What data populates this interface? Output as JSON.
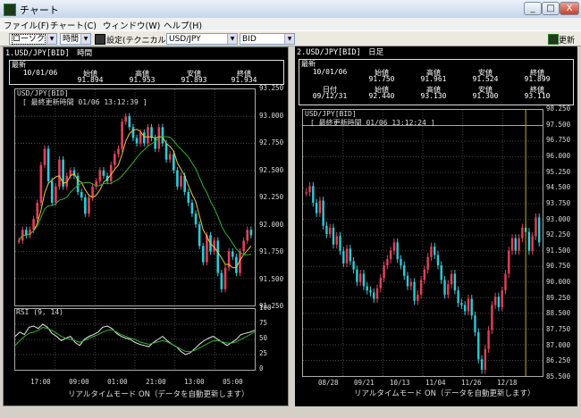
{
  "window": {
    "title": "チャート",
    "btn_min": "_",
    "btn_max": "□",
    "btn_close": "X"
  },
  "menu": [
    "ファイル(F)",
    "チャート(C)",
    "ウィンドウ(W)",
    "ヘルプ(H)"
  ],
  "toolbar": {
    "chart_type": "ローソク",
    "period": "時間",
    "settings_label": "設定(テクニカル)",
    "symbol": "USD/JPY",
    "price_type": "BID",
    "refresh_label": "更新"
  },
  "left": {
    "title": "1.USD/JPY[BID]　時間",
    "quote": {
      "label": "最新",
      "date": "10/01/06",
      "headers": [
        "始値",
        "高値",
        "安値",
        "終値"
      ],
      "values": [
        "91.894",
        "91.953",
        "91.893",
        "91.934"
      ]
    },
    "chart_title": "USD/JPY[BID]",
    "updated": "[ 最終更新時間 01/06 13:12:39 ]",
    "rsi_label": "RSI (9, 14)",
    "status": "リアルタイムモード ON（データを自動更新します）"
  },
  "right": {
    "title": "2.USD/JPY[BID]　日足",
    "quote": {
      "label": "最新",
      "date_header": "日付",
      "date": "10/01/06",
      "headers": [
        "始値",
        "高値",
        "安値",
        "終値"
      ],
      "values": [
        "91.750",
        "91.961",
        "91.524",
        "91.899"
      ],
      "date2": "09/12/31",
      "values2": [
        "92.440",
        "93.130",
        "91.300",
        "93.110"
      ]
    },
    "chart_title": "USD/JPY[BID]",
    "updated": "[ 最終更新時間 01/06 13:12:24 ]",
    "status": "リアルタイムモード ON（データを自動更新します）"
  },
  "colors": {
    "up": "#e0405a",
    "down": "#30c8d8",
    "ma_short": "#e8c830",
    "ma_long": "#30b030",
    "rsi_a": "#e8e8e8",
    "rsi_b": "#30b030"
  },
  "chart_data": [
    {
      "type": "candlestick",
      "title": "USD/JPY[BID] 時間",
      "ylim": [
        91.25,
        93.25
      ],
      "yticks": [
        "93.250",
        "93.000",
        "92.750",
        "92.500",
        "92.250",
        "92.000",
        "91.750",
        "91.500",
        "91.250"
      ],
      "xticks": [
        "17:00",
        "09:00",
        "01:00",
        "21:00",
        "13:00",
        "05:00"
      ],
      "close": [
        91.85,
        91.95,
        91.9,
        91.95,
        92.05,
        92.2,
        92.55,
        92.7,
        92.4,
        92.2,
        92.35,
        92.6,
        92.35,
        92.45,
        92.5,
        92.45,
        92.3,
        92.25,
        92.1,
        92.25,
        92.35,
        92.4,
        92.5,
        92.45,
        92.4,
        92.55,
        92.65,
        92.7,
        92.95,
        93.0,
        92.9,
        92.8,
        92.75,
        92.85,
        92.75,
        92.9,
        92.8,
        92.7,
        92.9,
        92.75,
        92.6,
        92.65,
        92.5,
        92.35,
        92.45,
        92.3,
        92.2,
        92.1,
        92.0,
        91.8,
        91.65,
        91.9,
        91.75,
        91.85,
        91.55,
        91.4,
        91.6,
        91.75,
        91.7,
        91.55,
        91.75,
        91.85,
        91.95,
        91.9
      ],
      "rsi": [
        [
          55,
          62,
          58,
          70,
          72,
          68,
          75,
          70,
          60,
          55,
          48,
          52,
          55,
          45,
          40,
          50,
          55,
          58,
          62,
          70,
          72,
          68,
          60,
          55,
          52,
          50,
          45,
          42,
          40,
          38,
          45,
          50,
          55,
          48,
          42,
          38,
          30,
          25,
          28,
          35,
          42,
          48,
          52,
          55,
          50,
          45,
          40,
          45,
          50,
          58,
          60,
          62,
          65
        ],
        [
          40,
          48,
          55,
          60,
          62,
          65,
          70,
          68,
          65,
          60,
          55,
          52,
          50,
          48,
          45,
          48,
          52,
          55,
          58,
          62,
          65,
          66,
          62,
          58,
          55,
          52,
          50,
          46,
          44,
          42,
          44,
          46,
          48,
          46,
          42,
          38,
          34,
          30,
          30,
          32,
          36,
          40,
          44,
          48,
          48,
          46,
          44,
          44,
          46,
          50,
          54,
          58,
          62
        ]
      ],
      "rsi_ylim": [
        0,
        100
      ],
      "rsi_yticks": [
        "100",
        "75",
        "50",
        "25",
        "0"
      ]
    },
    {
      "type": "candlestick",
      "title": "USD/JPY[BID] 日足",
      "ylim": [
        85.5,
        98.25
      ],
      "yticks": [
        "98.250",
        "97.500",
        "96.750",
        "96.000",
        "95.250",
        "94.500",
        "93.750",
        "93.000",
        "92.250",
        "91.500",
        "90.750",
        "90.000",
        "89.250",
        "88.500",
        "87.750",
        "87.000",
        "86.250",
        "85.500"
      ],
      "xticks": [
        "08/28",
        "09/21",
        "10/13",
        "11/04",
        "11/26",
        "12/18"
      ],
      "close": [
        94.3,
        94.6,
        93.8,
        93.3,
        93.9,
        92.7,
        92.3,
        92.6,
        91.8,
        92.2,
        91.5,
        90.9,
        91.6,
        91.0,
        90.6,
        90.0,
        90.4,
        89.8,
        89.6,
        89.5,
        89.2,
        89.7,
        90.2,
        90.8,
        91.1,
        91.5,
        91.9,
        91.1,
        90.8,
        90.3,
        89.8,
        90.0,
        89.1,
        89.4,
        90.1,
        90.6,
        91.2,
        91.7,
        91.3,
        90.8,
        90.1,
        89.4,
        89.9,
        90.4,
        89.6,
        89.0,
        88.9,
        88.6,
        89.2,
        88.4,
        87.6,
        86.3,
        85.8,
        86.8,
        87.7,
        88.9,
        89.3,
        88.8,
        89.6,
        90.4,
        91.5,
        92.1,
        91.5,
        92.1,
        92.6,
        92.4,
        91.5,
        92.2,
        93.1,
        91.9
      ]
    }
  ]
}
